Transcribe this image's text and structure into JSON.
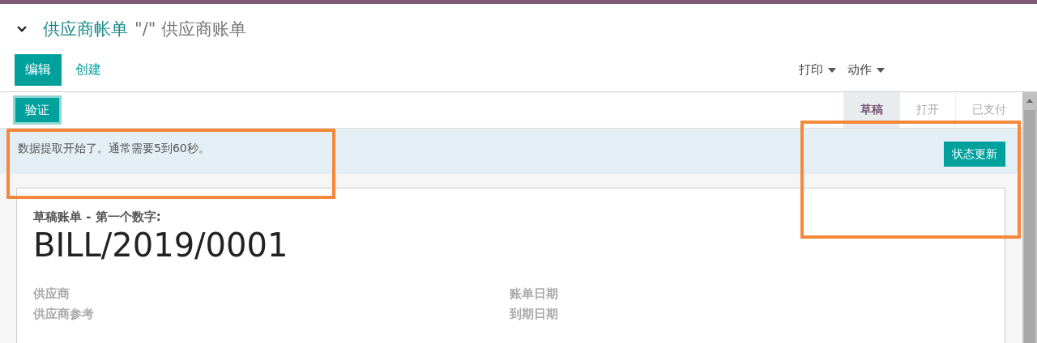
{
  "breadcrumb": {
    "parent": "供应商帐单",
    "current": "\"/\" 供应商账单",
    "expanded": true
  },
  "buttons": [
    {
      "label": "编辑",
      "kind": "primary"
    },
    {
      "label": "创建",
      "kind": "link"
    }
  ],
  "menus": [
    {
      "label": "打印"
    },
    {
      "label": "动作"
    }
  ],
  "statusbar": {
    "action": "验证",
    "steps": [
      {
        "label": "草稿",
        "selected": true
      },
      {
        "label": "打开",
        "selected": false
      },
      {
        "label": "已支付",
        "selected": false
      }
    ]
  },
  "message": {
    "text": "数据提取开始了。通常需要5到60秒。",
    "button": "状态更新",
    "highlighted": true,
    "button_highlighted": true
  },
  "sheet": {
    "label": "草稿账单 - 第一个数字:",
    "number": "BILL/2019/0001",
    "fields_left": [
      "供应商",
      "供应商参考"
    ],
    "fields_right": [
      "账单日期",
      "到期日期"
    ]
  }
}
